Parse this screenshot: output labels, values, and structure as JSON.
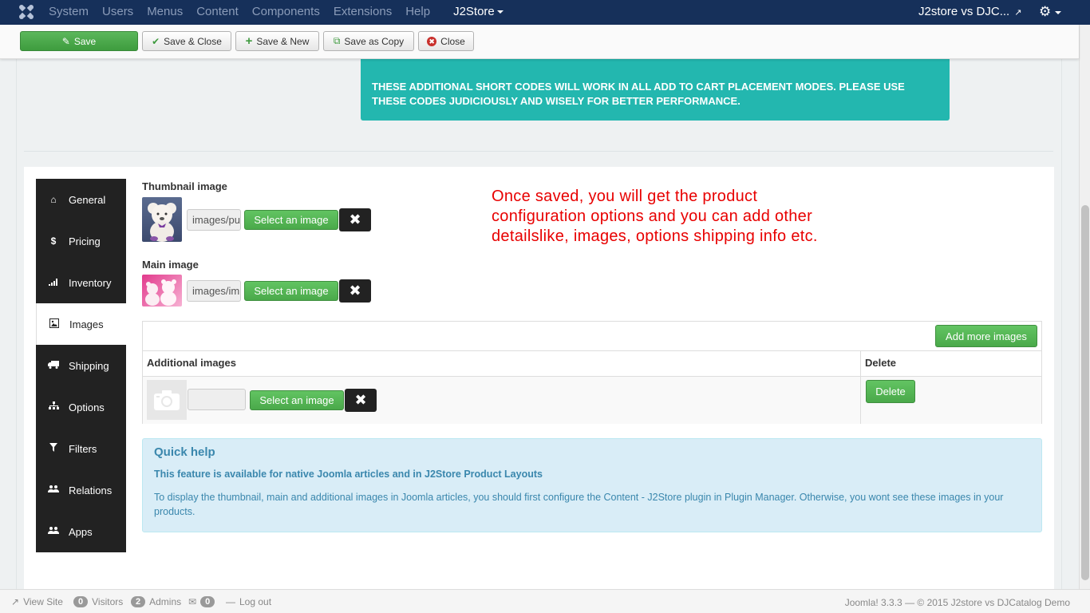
{
  "navbar": {
    "menu": [
      "System",
      "Users",
      "Menus",
      "Content",
      "Components",
      "Extensions",
      "Help"
    ],
    "active_menu": "J2Store",
    "site_name": "J2store vs DJC...",
    "icons": {
      "logo": "joomla-logo-icon",
      "external": "external-link-icon",
      "settings": "gear-icon"
    }
  },
  "toolbar": {
    "save": "Save",
    "save_close": "Save & Close",
    "save_new": "Save & New",
    "save_copy": "Save as Copy",
    "close": "Close"
  },
  "alert": {
    "text": "THESE ADDITIONAL SHORT CODES WILL WORK IN ALL ADD TO CART PLACEMENT MODES. PLEASE USE THESE CODES JUDICIOUSLY AND WISELY FOR BETTER PERFORMANCE.",
    "color": "#23b7af"
  },
  "tabs": [
    {
      "label": "General",
      "icon": "home-icon"
    },
    {
      "label": "Pricing",
      "icon": "dollar-icon"
    },
    {
      "label": "Inventory",
      "icon": "signal-icon"
    },
    {
      "label": "Images",
      "icon": "image-icon"
    },
    {
      "label": "Shipping",
      "icon": "truck-icon"
    },
    {
      "label": "Options",
      "icon": "sitemap-icon"
    },
    {
      "label": "Filters",
      "icon": "filter-icon"
    },
    {
      "label": "Relations",
      "icon": "users-icon"
    },
    {
      "label": "Apps",
      "icon": "users-icon"
    }
  ],
  "active_tab": "Images",
  "images": {
    "thumbnail_label": "Thumbnail image",
    "thumbnail_path": "images/pu",
    "main_label": "Main image",
    "main_path": "images/im",
    "select_label": "Select an image",
    "clear_icon": "close-icon"
  },
  "note": "Once saved, you will get the product configuration options and you can add other detailslike, images, options shipping info etc.",
  "additional": {
    "add_more": "Add more images",
    "col_images": "Additional images",
    "col_delete": "Delete",
    "row_path": "",
    "select_label": "Select an image",
    "delete_label": "Delete"
  },
  "help": {
    "title": "Quick help",
    "bold": "This feature is available for native Joomla articles and in J2Store Product Layouts",
    "text": "To display the thumbnail, main and additional images in Joomla articles, you should first configure the Content - J2Store plugin in Plugin Manager. Otherwise, you wont see these images in your products."
  },
  "status": {
    "view_site": "View Site",
    "visitors_count": "0",
    "visitors": "Visitors",
    "admins_count": "2",
    "admins": "Admins",
    "messages_count": "0",
    "logout": "Log out",
    "footer": "Joomla! 3.3.3  —  © 2015 J2store vs DJCatalog Demo"
  }
}
